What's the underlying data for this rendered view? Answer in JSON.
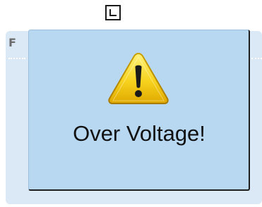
{
  "indicator": {
    "icon": "corner-l-icon"
  },
  "background_panel": {
    "label": "F"
  },
  "alert": {
    "icon": "warning-triangle-icon",
    "message": "Over Voltage!",
    "colors": {
      "popup_background": "#b8d8f2",
      "panel_background": "#dbe9f6",
      "warning_fill": "#f7d31e",
      "text": "#111111"
    }
  }
}
